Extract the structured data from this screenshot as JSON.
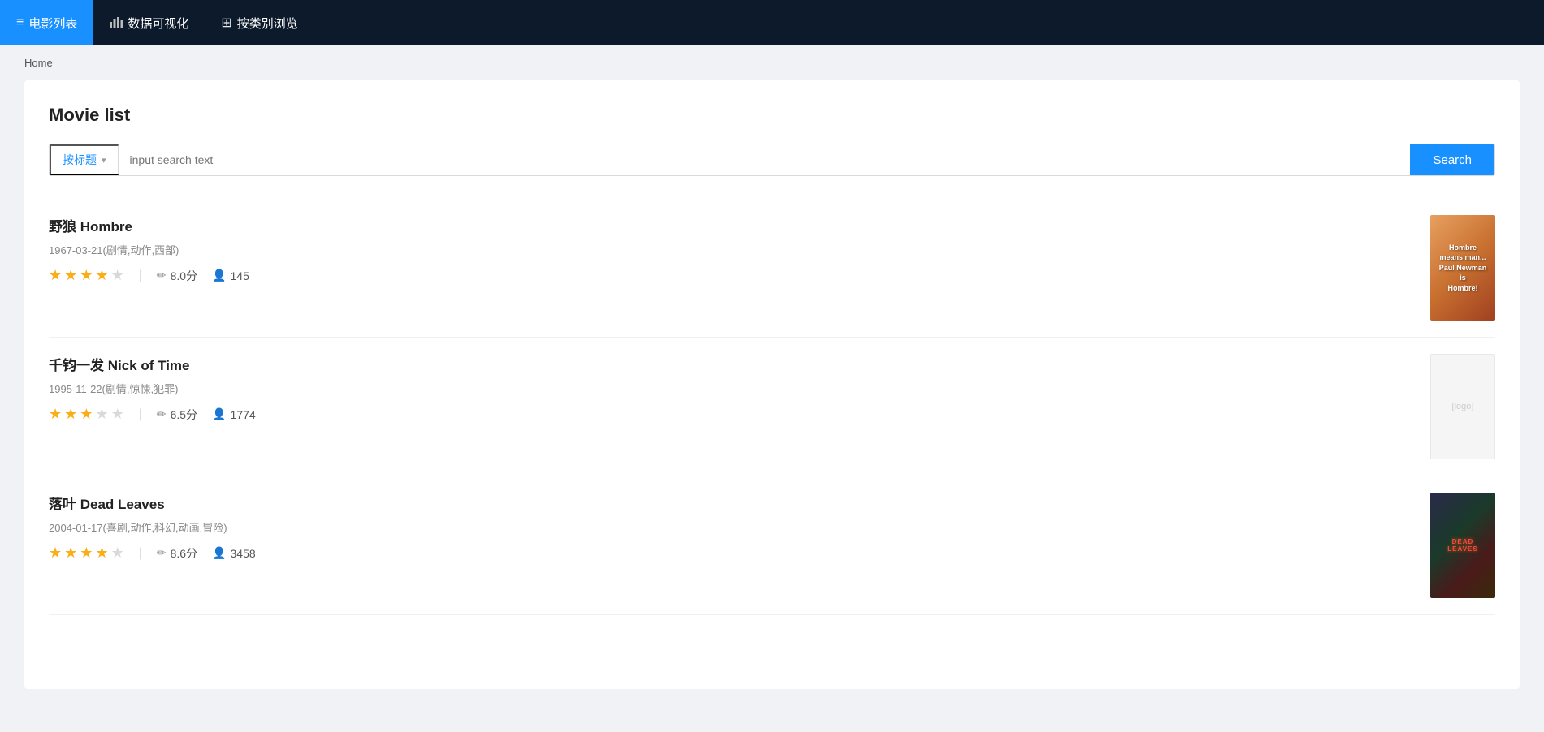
{
  "navbar": {
    "items": [
      {
        "id": "movie-list",
        "label": "电影列表",
        "icon": "≡",
        "active": true
      },
      {
        "id": "data-viz",
        "label": "数据可视化",
        "icon": "📊",
        "active": false
      },
      {
        "id": "browse-category",
        "label": "按类别浏览",
        "icon": "⊞",
        "active": false
      }
    ]
  },
  "breadcrumb": "Home",
  "page": {
    "title": "Movie list",
    "search": {
      "type_label": "按标题",
      "placeholder": "input search text",
      "button_label": "Search"
    }
  },
  "movies": [
    {
      "id": 1,
      "title": "野狼 Hombre",
      "date": "1967-03-21",
      "genres": "剧情,动作,西部",
      "rating": 8.0,
      "rating_display": "8.0分",
      "votes": 145,
      "stars_filled": 4,
      "stars_empty": 1,
      "poster_type": "hombre",
      "poster_text": "Hombre\nmeans man...\nPaul Newman is\nHombre!"
    },
    {
      "id": 2,
      "title": "千钧一发 Nick of Time",
      "date": "1995-11-22",
      "genres": "剧情,惊悚,犯罪",
      "rating": 6.5,
      "rating_display": "6.5分",
      "votes": 1774,
      "stars_filled": 3,
      "stars_empty": 2,
      "poster_type": "placeholder",
      "poster_text": "[logo]"
    },
    {
      "id": 3,
      "title": "落叶 Dead Leaves",
      "date": "2004-01-17",
      "genres": "喜剧,动作,科幻,动画,冒险",
      "rating": 8.6,
      "rating_display": "8.6分",
      "votes": 3458,
      "stars_filled": 4,
      "stars_empty": 1,
      "poster_type": "deadleaves",
      "poster_text": "DEAD\nLEAVES"
    }
  ],
  "icons": {
    "edit": "✏",
    "user": "👤",
    "chevron_down": "▾"
  }
}
